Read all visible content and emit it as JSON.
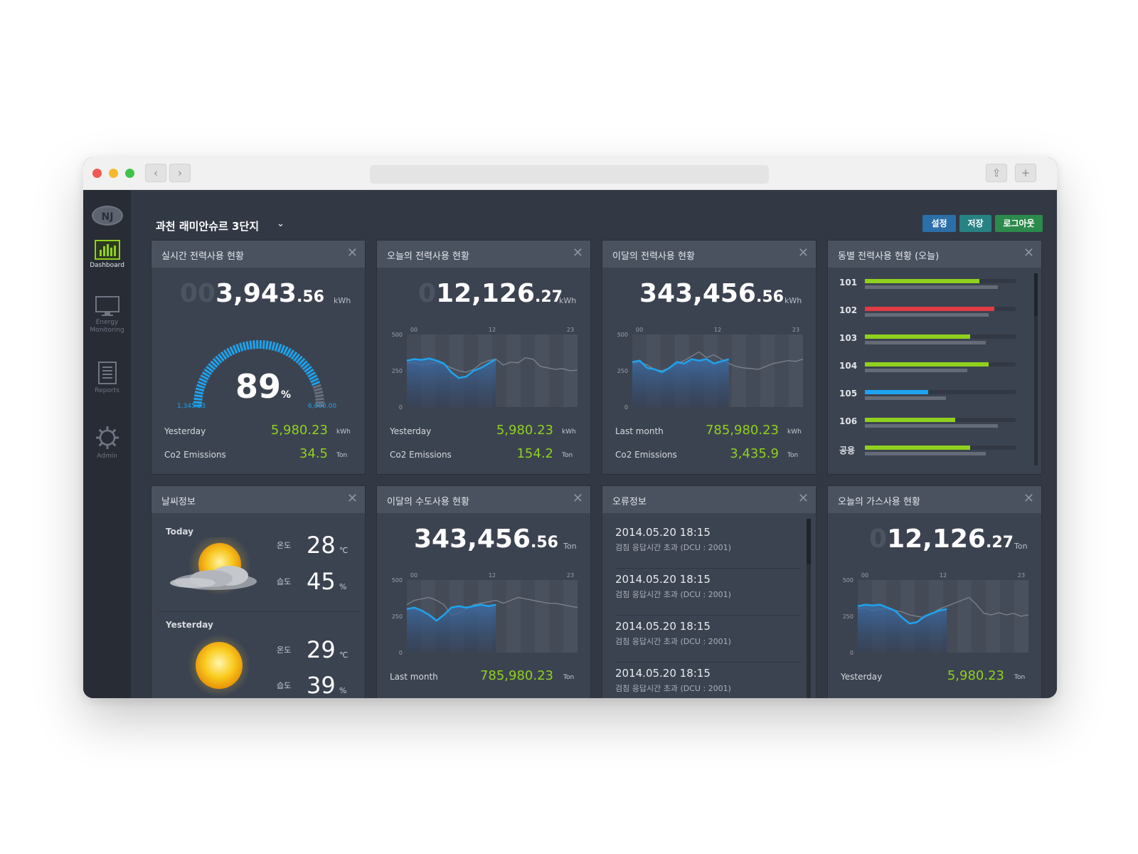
{
  "browser": {
    "dots": [
      "#ed5b52",
      "#f5b92d",
      "#3fc34a"
    ],
    "back_icon": "‹",
    "forward_icon": "›",
    "share_icon": "⇪",
    "newtab_icon": "+"
  },
  "sidebar": {
    "logo": "NJ",
    "items": [
      {
        "label": "Dashboard",
        "icon": "bar-chart-icon",
        "active": true
      },
      {
        "label": "Energy Monitoring",
        "icon": "monitor-icon",
        "active": false
      },
      {
        "label": "Reports",
        "icon": "document-icon",
        "active": false
      },
      {
        "label": "Admin",
        "icon": "gear-icon",
        "active": false
      }
    ]
  },
  "header": {
    "site": "과천 래미안슈르 3단지",
    "dropdown_icon": "⌄",
    "buttons": [
      {
        "label": "설정",
        "color": "#2b6fa8"
      },
      {
        "label": "저장",
        "color": "#278284"
      },
      {
        "label": "로그아웃",
        "color": "#2c8a4c"
      }
    ]
  },
  "close_icon": "✕",
  "panels": {
    "realtime": {
      "title": "실시간 전력사용 현황",
      "ghost": "00",
      "value": "3,943",
      "decimal": ".56",
      "unit": "kWh",
      "gauge_percent": 89,
      "percent_text": "89",
      "percent_unit": "%",
      "gauge_min": "1,345.23",
      "gauge_max": "6,000.00",
      "stats": [
        {
          "label": "Yesterday",
          "value": "5,980.23",
          "unit": "kWh"
        },
        {
          "label": "Co2 Emissions",
          "value": "34.5",
          "unit": "Ton"
        }
      ]
    },
    "today": {
      "title": "오늘의 전력사용 현황",
      "ghost": "0",
      "value": "12,126",
      "decimal": ".27",
      "unit": "kWh",
      "stats": [
        {
          "label": "Yesterday",
          "value": "5,980.23",
          "unit": "kWh"
        },
        {
          "label": "Co2 Emissions",
          "value": "154.2",
          "unit": "Ton"
        }
      ]
    },
    "month": {
      "title": "이달의 전력사용 현황",
      "ghost": "",
      "value": "343,456",
      "decimal": ".56",
      "unit": "kWh",
      "stats": [
        {
          "label": "Last month",
          "value": "785,980.23",
          "unit": "kWh"
        },
        {
          "label": "Co2 Emissions",
          "value": "3,435.9",
          "unit": "Ton"
        }
      ]
    },
    "byunit": {
      "title": "동별 전력사용 현황 (오늘)"
    },
    "weather": {
      "title": "날씨정보",
      "today_label": "Today",
      "yesterday_label": "Yesterday",
      "temp_label": "온도",
      "hum_label": "습도",
      "today_temp": "28",
      "today_temp_unit": "℃",
      "today_hum": "45",
      "today_hum_unit": "%",
      "yesterday_temp": "29",
      "yesterday_temp_unit": "℃",
      "yesterday_hum": "39",
      "yesterday_hum_unit": "%",
      "today_icon": "partly-cloudy-icon",
      "yesterday_icon": "sun-icon"
    },
    "water": {
      "title": "이달의 수도사용 현황",
      "ghost": "",
      "value": "343,456",
      "decimal": ".56",
      "unit": "Ton",
      "stats": [
        {
          "label": "Last month",
          "value": "785,980.23",
          "unit": "Ton"
        }
      ]
    },
    "errors": {
      "title": "오류정보",
      "items": [
        {
          "time": "2014.05.20 18:15",
          "msg": "검침 응답시간 초과 (DCU : 2001)"
        },
        {
          "time": "2014.05.20 18:15",
          "msg": "검침 응답시간 초과 (DCU : 2001)"
        },
        {
          "time": "2014.05.20 18:15",
          "msg": "검침 응답시간 초과 (DCU : 2001)"
        },
        {
          "time": "2014.05.20 18:15",
          "msg": "검침 응답시간 초과 (DCU : 2001)"
        }
      ]
    },
    "gas": {
      "title": "오늘의 가스사용 현황",
      "ghost": "0",
      "value": "12,126",
      "decimal": ".27",
      "unit": "Ton",
      "stats": [
        {
          "label": "Yesterday",
          "value": "5,980.23",
          "unit": "Ton"
        }
      ]
    }
  },
  "chart_data": [
    {
      "id": "today-power",
      "type": "line",
      "x_ticks": [
        "00",
        "12",
        "23"
      ],
      "y_ticks": [
        "500",
        "250",
        "0"
      ],
      "ylim": [
        0,
        500
      ],
      "series": [
        {
          "name": "",
          "color": "#7d838e",
          "values": [
            300,
            310,
            290,
            300,
            305,
            295,
            270,
            250,
            240,
            260,
            300,
            320,
            330,
            290,
            310,
            305,
            340,
            330,
            280,
            270,
            260,
            265,
            250,
            255
          ]
        },
        {
          "name": "",
          "color": "#1ea3ee",
          "area": true,
          "values": [
            320,
            330,
            325,
            335,
            320,
            300,
            240,
            200,
            210,
            250,
            270,
            300,
            330
          ]
        }
      ]
    },
    {
      "id": "month-power",
      "type": "line",
      "x_ticks": [
        "00",
        "12",
        "23"
      ],
      "y_ticks": [
        "500",
        "250",
        "0"
      ],
      "ylim": [
        0,
        500
      ],
      "series": [
        {
          "name": "",
          "color": "#7d838e",
          "values": [
            300,
            310,
            290,
            260,
            250,
            270,
            300,
            320,
            350,
            380,
            340,
            360,
            330,
            300,
            280,
            270,
            265,
            260,
            280,
            300,
            310,
            320,
            315,
            330
          ]
        },
        {
          "name": "",
          "color": "#1ea3ee",
          "area": true,
          "values": [
            310,
            320,
            270,
            260,
            240,
            270,
            310,
            300,
            330,
            320,
            330,
            300,
            315,
            330
          ]
        }
      ]
    },
    {
      "id": "water",
      "type": "line",
      "x_ticks": [
        "00",
        "12",
        "23"
      ],
      "y_ticks": [
        "500",
        "250",
        "0"
      ],
      "ylim": [
        0,
        500
      ],
      "series": [
        {
          "name": "",
          "color": "#7d838e",
          "values": [
            330,
            360,
            370,
            380,
            360,
            330,
            260,
            270,
            300,
            330,
            340,
            350,
            360,
            340,
            360,
            380,
            370,
            360,
            350,
            340,
            340,
            330,
            320,
            310
          ]
        },
        {
          "name": "",
          "color": "#1ea3ee",
          "area": true,
          "values": [
            300,
            310,
            290,
            260,
            220,
            260,
            310,
            320,
            310,
            320,
            330,
            320,
            330
          ]
        }
      ]
    },
    {
      "id": "gas",
      "type": "line",
      "x_ticks": [
        "00",
        "12",
        "23"
      ],
      "y_ticks": [
        "500",
        "250",
        "0"
      ],
      "ylim": [
        0,
        500
      ],
      "series": [
        {
          "name": "",
          "color": "#7d838e",
          "values": [
            300,
            310,
            290,
            300,
            300,
            290,
            280,
            260,
            250,
            240,
            270,
            300,
            320,
            340,
            360,
            380,
            330,
            270,
            260,
            275,
            260,
            270,
            250,
            260
          ]
        },
        {
          "name": "",
          "color": "#1ea3ee",
          "area": true,
          "values": [
            320,
            330,
            325,
            330,
            310,
            290,
            240,
            200,
            210,
            250,
            270,
            290,
            300
          ]
        }
      ]
    },
    {
      "id": "by-unit",
      "type": "bar",
      "categories": [
        "101",
        "102",
        "103",
        "104",
        "105",
        "106",
        "공용"
      ],
      "series": [
        {
          "name": "",
          "values": [
            0.76,
            0.86,
            0.7,
            0.82,
            0.42,
            0.6,
            0.7
          ],
          "colors": [
            "#8fd11e",
            "#e33b45",
            "#8fd11e",
            "#8fd11e",
            "#1ea3ee",
            "#8fd11e",
            "#8fd11e"
          ]
        },
        {
          "name": "",
          "color": "#656c78",
          "values": [
            0.88,
            0.82,
            0.8,
            0.68,
            0.54,
            0.88,
            0.8
          ]
        }
      ],
      "xlim": [
        0,
        1
      ]
    }
  ]
}
